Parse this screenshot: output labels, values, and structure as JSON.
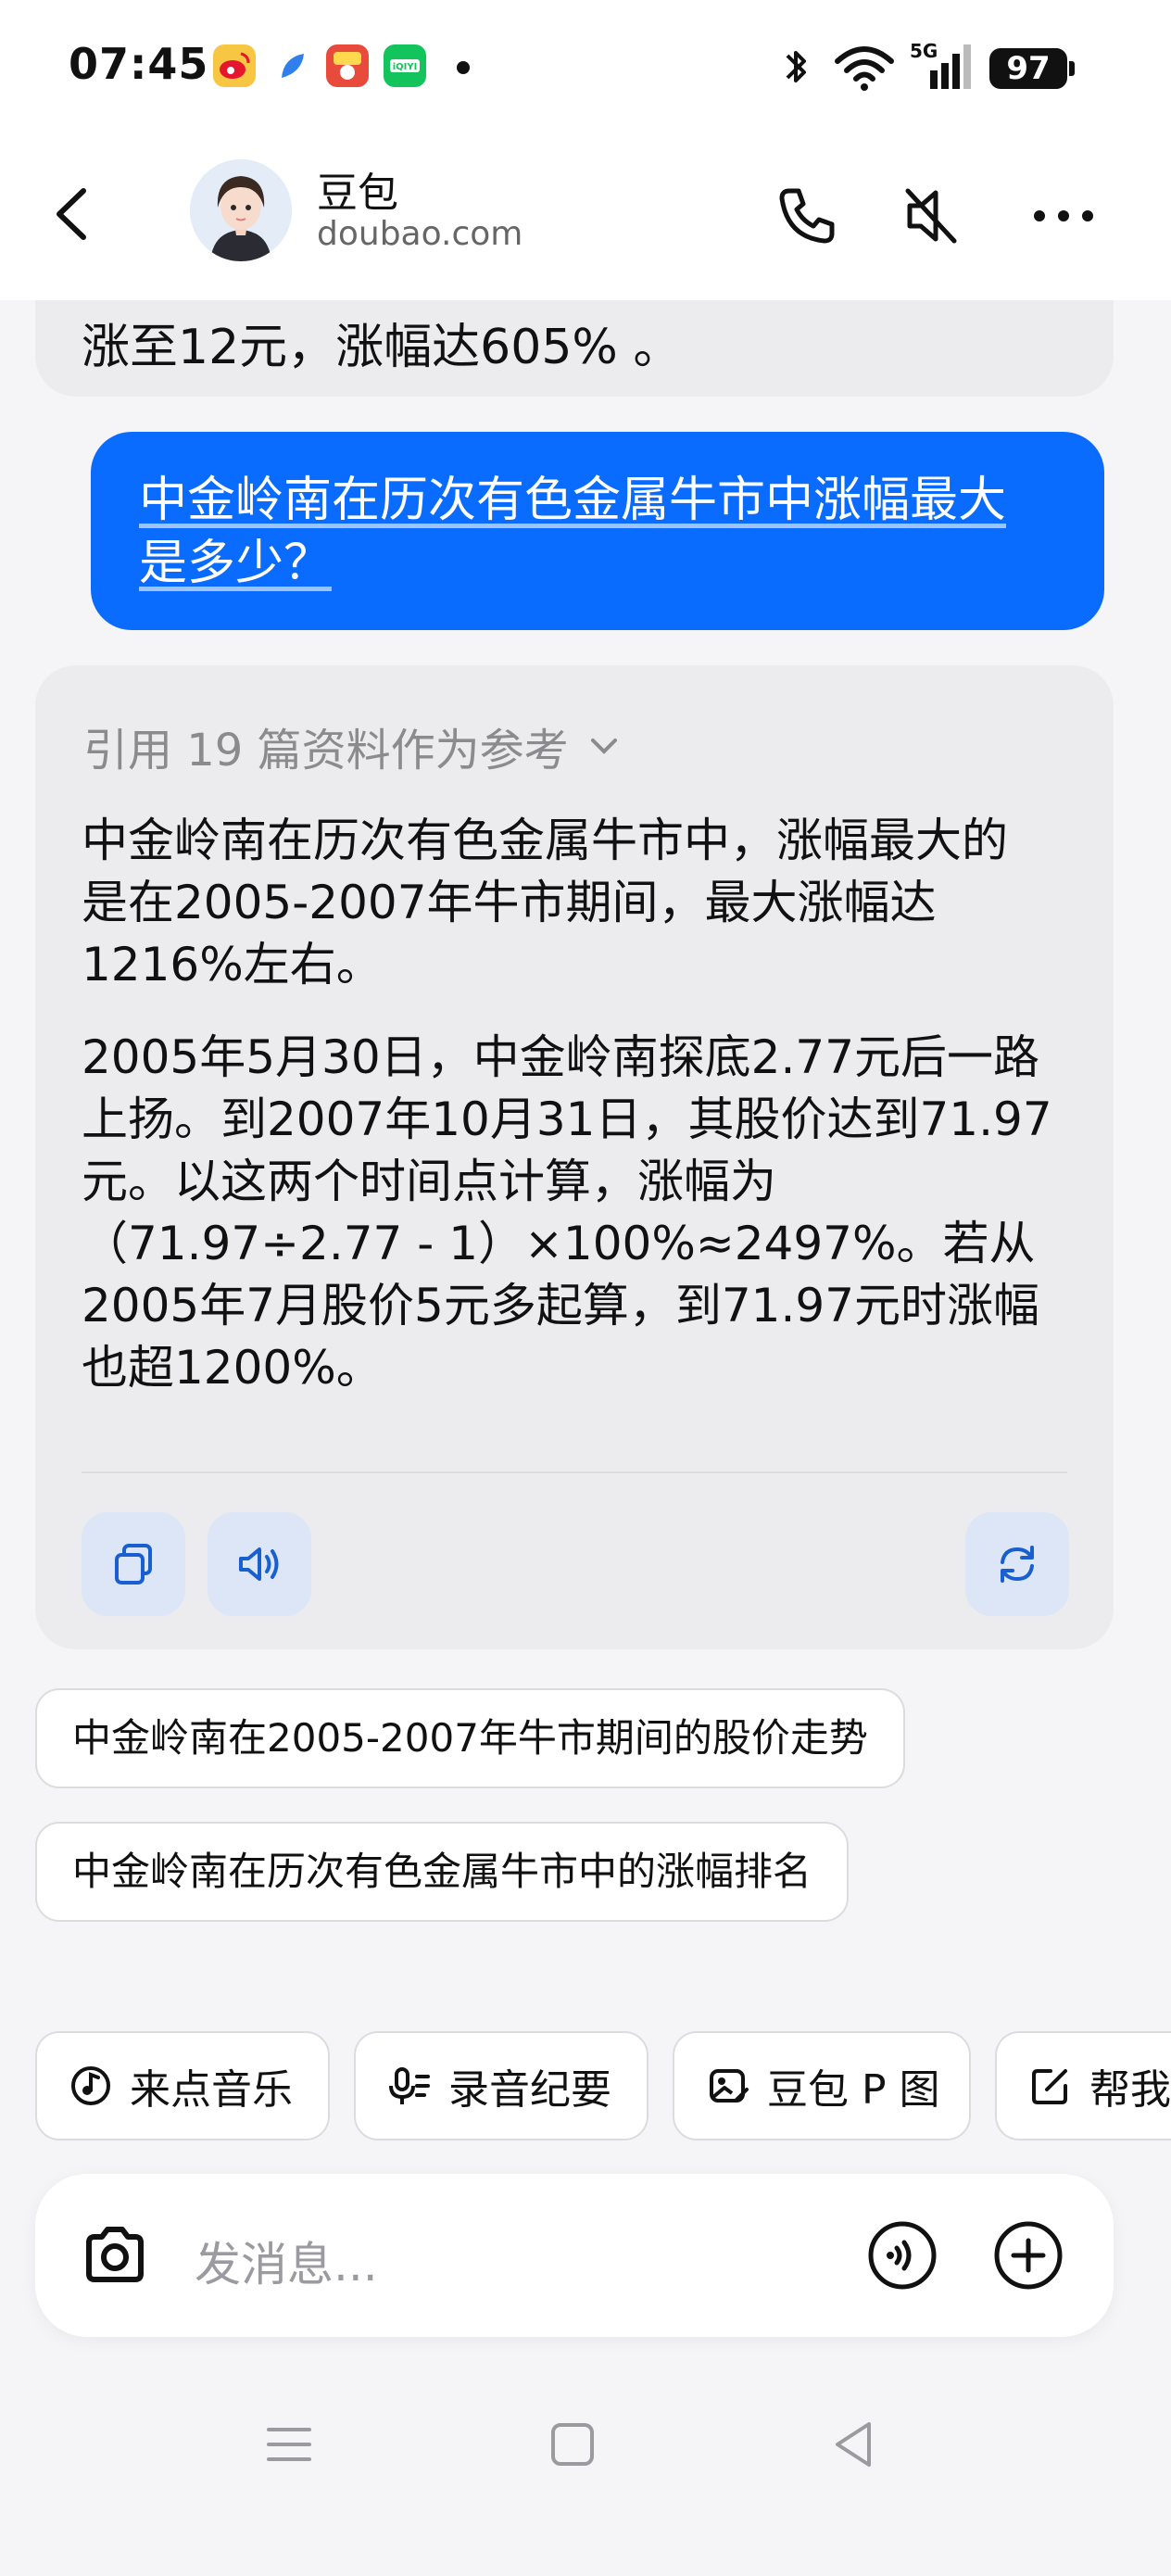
{
  "status_bar": {
    "time": "07:45",
    "network": "5G",
    "battery": "97",
    "notification_icons": [
      "weibo-icon",
      "feather-app-icon",
      "waimai-app-icon",
      "iqiyi-icon"
    ]
  },
  "header": {
    "back_icon": "chevron-left-icon",
    "bot_name": "豆包",
    "bot_domain": "doubao.com",
    "icons": [
      "phone-icon",
      "speaker-muted-icon",
      "more-icon"
    ]
  },
  "chat": {
    "previous_message_tail": "涨至12元，涨幅达605% 。",
    "user_message": {
      "line1": "中金岭南在历次有色金属牛市中涨幅最大",
      "line2": "是多少？"
    },
    "bot_message": {
      "references": "引用 19 篇资料作为参考",
      "paragraph1": [
        "中金岭南在历次有色金属牛市中，涨幅最大的",
        "是在2005-2007年牛市期间，最大涨幅达",
        "1216%左右。"
      ],
      "paragraph2": [
        "2005年5月30日，中金岭南探底2.77元后一路",
        "上扬。到2007年10月31日，其股价达到71.97",
        "元。以这两个时间点计算，涨幅为",
        "（71.97÷2.77 - 1）×100%≈2497%。若从",
        "2005年7月股价5元多起算，到71.97元时涨幅",
        "也超1200%。"
      ],
      "actions": [
        "copy-icon",
        "speaker-icon",
        "regenerate-icon"
      ]
    },
    "suggestions": [
      "中金岭南在2005-2007年牛市期间的股价走势",
      "中金岭南在历次有色金属牛市中的涨幅排名"
    ]
  },
  "quick_actions": [
    {
      "icon": "music-icon",
      "label": "来点音乐"
    },
    {
      "icon": "mic-notes-icon",
      "label": "录音纪要"
    },
    {
      "icon": "image-edit-icon",
      "label": "豆包 P 图"
    },
    {
      "icon": "edit-icon",
      "label": "帮我"
    }
  ],
  "input": {
    "placeholder": "发消息..."
  },
  "nav": [
    "menu-icon",
    "home-icon",
    "back-icon"
  ]
}
